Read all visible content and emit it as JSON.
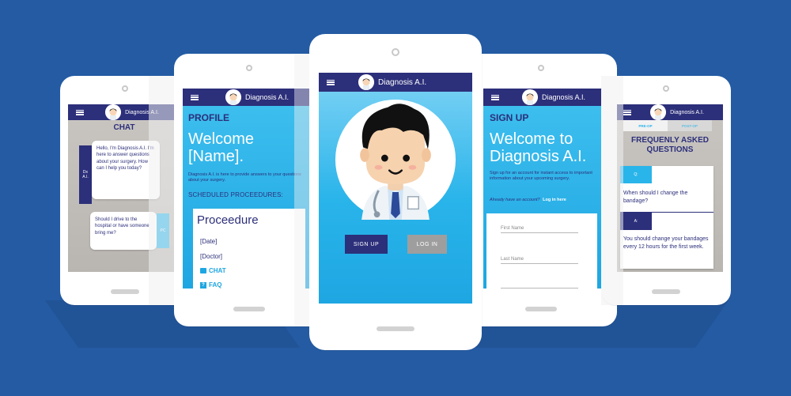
{
  "brand": {
    "name": "Diagnosis A.I."
  },
  "colors": {
    "background": "#245ba3",
    "navy": "#2c2f7a",
    "sky": "#29b4ea",
    "gray_button": "#9e9e9e"
  },
  "chat": {
    "title": "CHAT",
    "ai_avatar": "Dx\nA.I.",
    "ai_message": "Hello, I'm Diagnosis A.I. I'm here to answer questions about your surgery. How can I help you today?",
    "user_message": "Should I drive to the hospital or have someone bring me?",
    "user_avatar": "PC"
  },
  "profile": {
    "title": "PROFILE",
    "welcome": "Welcome [Name].",
    "intro": "Diagnosis A.I. is here to provide answers to your questions about your surgery.",
    "scheduled_label": "SCHEDULED PROCEEDURES:",
    "card_title": "Proceedure",
    "date": "[Date]",
    "doctor": "[Doctor]",
    "chat_link": "CHAT",
    "faq_link": "FAQ"
  },
  "home": {
    "signup_button": "SIGN UP",
    "login_button": "LOG IN"
  },
  "signup": {
    "title": "SIGN UP",
    "welcome": "Welcome to Diagnosis A.I.",
    "intro": "Sign up for an account for instant access to important information about your upcoming surgery.",
    "already": "Already have an account?",
    "login_link": "Log in here",
    "first_name_placeholder": "First Name",
    "last_name_placeholder": "Last Name"
  },
  "faq": {
    "tab_preop": "PRE-OP",
    "tab_postop": "POST-OP",
    "title": "FREQUENLY ASKED QUESTIONS",
    "q_badge": "Q:",
    "question": "When should I change the bandage?",
    "a_badge": "A:",
    "answer": "You should change your bandages every 12 hours for the first week."
  }
}
